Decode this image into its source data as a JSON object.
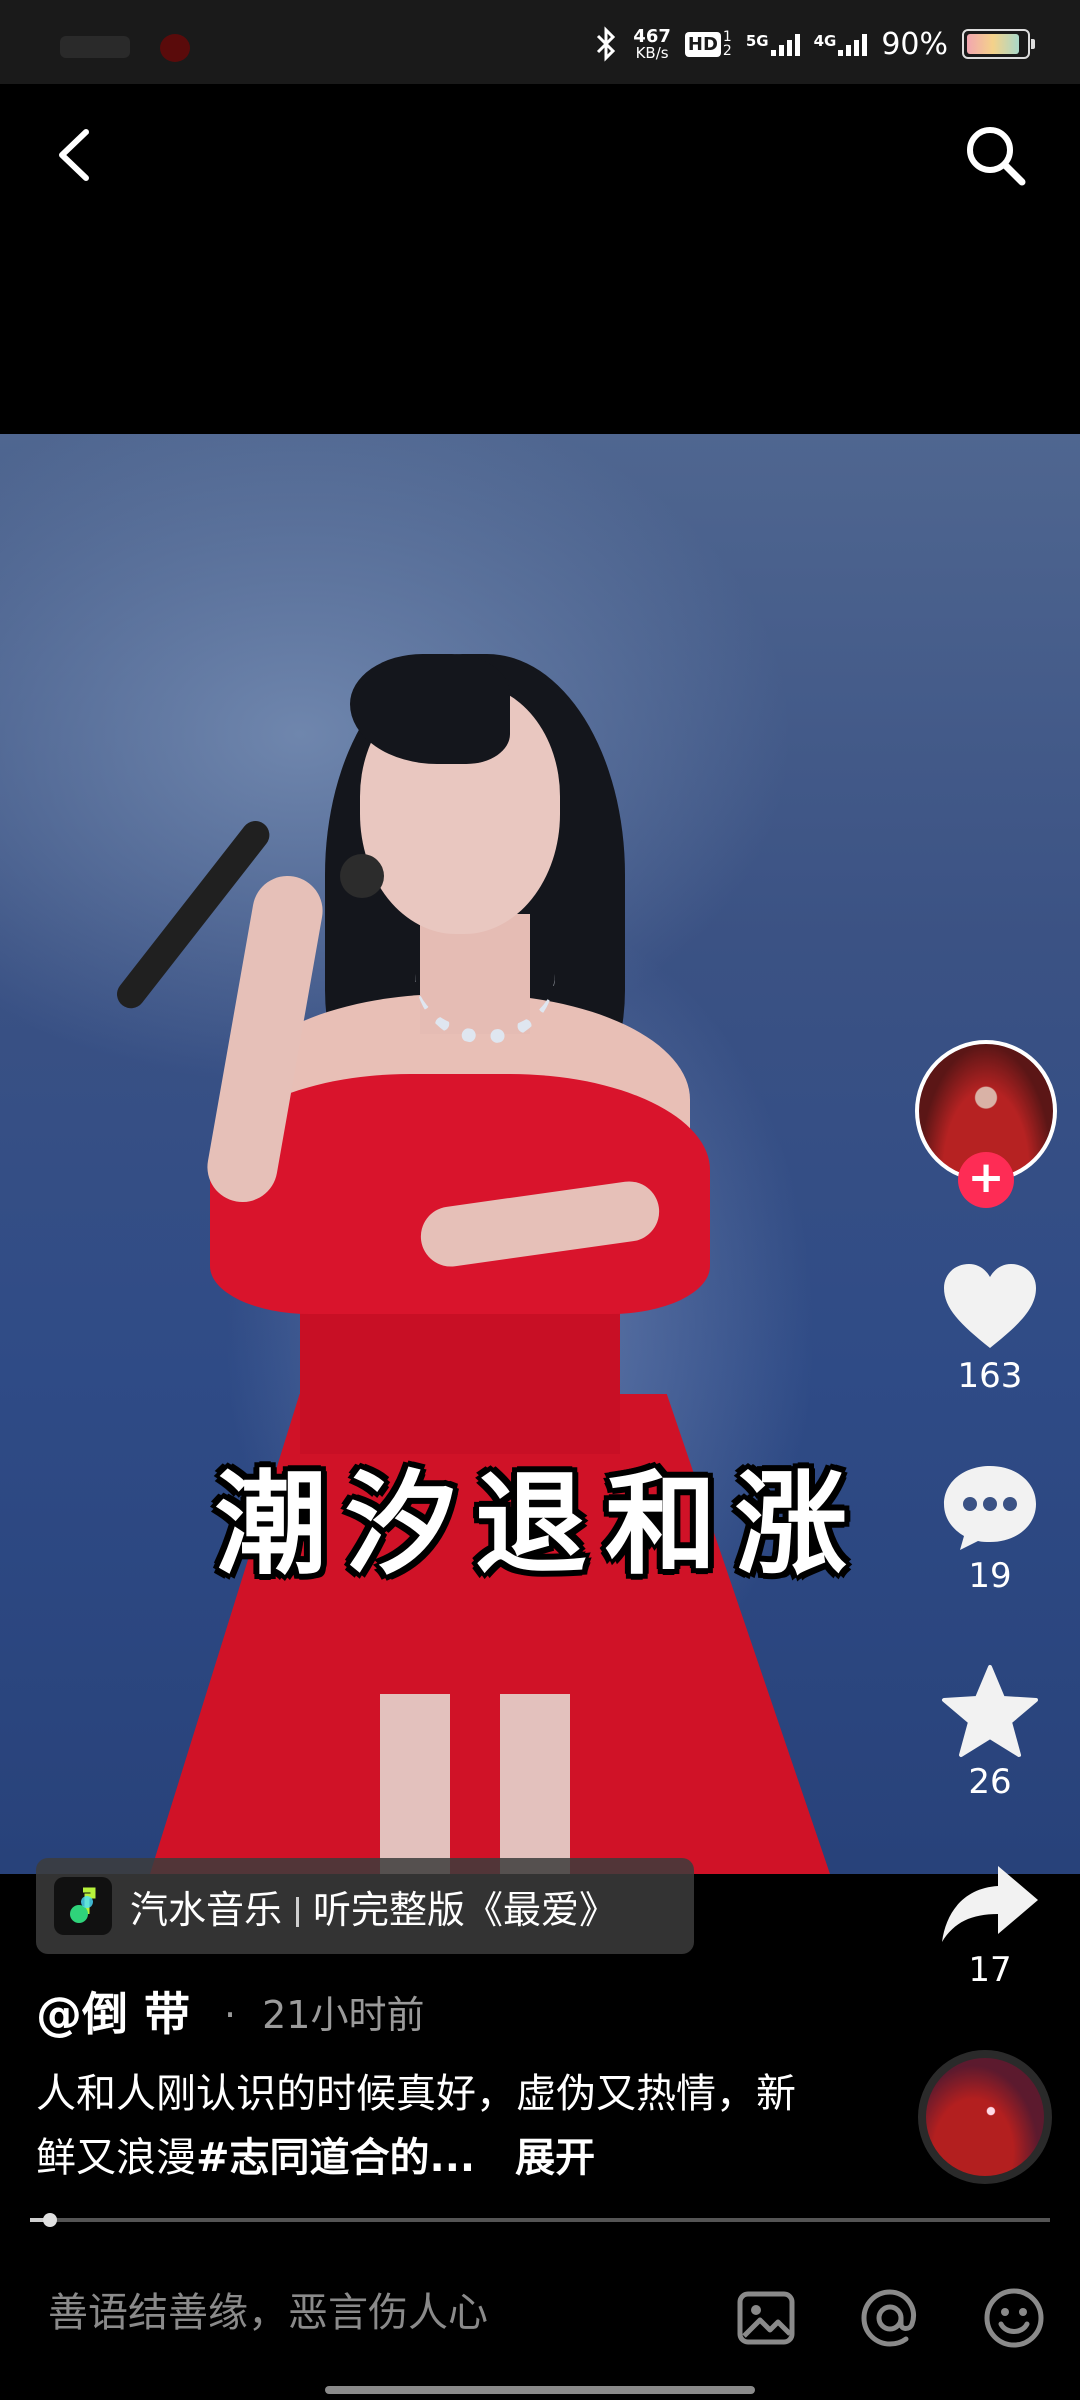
{
  "status_bar": {
    "net_speed_value": "467",
    "net_speed_unit": "KB/s",
    "hd_label": "HD",
    "hd_sub_top": "1",
    "hd_sub_bottom": "2",
    "net1_label": "5G",
    "net2_label": "4G",
    "battery_text": "90%",
    "battery_level": 0.9
  },
  "nav": {
    "back_icon": "chevron-left-icon",
    "search_icon": "search-icon"
  },
  "video": {
    "caption": "潮汐退和涨"
  },
  "actions": {
    "like_count": "163",
    "comment_count": "19",
    "favorite_count": "26",
    "share_count": "17",
    "follow_label": "+"
  },
  "music_chip": {
    "app_name": "汽水音乐",
    "action_text": "听完整版《最爱》"
  },
  "post": {
    "author": "@倒 带",
    "time_ago": "21小时前",
    "description": "人和人刚认识的时候真好，虚伪又热情，新鲜又浪漫",
    "hashtag": "#志同道合的...",
    "expand_label": "展开"
  },
  "progress": {
    "value": 0.02
  },
  "comment_bar": {
    "placeholder": "善语结善缘，恶言伤人心"
  },
  "colors": {
    "accent_red": "#fe2c55",
    "background": "#000000"
  }
}
